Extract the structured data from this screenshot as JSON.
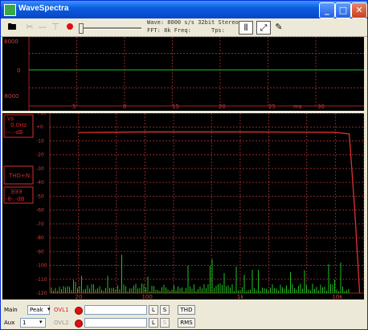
{
  "window": {
    "title": "WaveSpectra"
  },
  "titlebar_buttons": [
    "_",
    "□",
    "✕"
  ],
  "toolbar": {
    "info_line1": "Wave: 8000 s/s  32bit  Stereo",
    "info_line2": "FFT: 8k  Freq:",
    "tps_label": "Tps:"
  },
  "top_panel": {
    "y_labels": [
      "8000",
      "0",
      "-8000"
    ],
    "x_labels": [
      "5",
      "0",
      "15",
      "20",
      "25",
      "ms",
      "30"
    ]
  },
  "bottom_panel": {
    "left_box1": [
      "Vs",
      "0.0Hz",
      "---.-dB"
    ],
    "left_box2": "THD+N",
    "left_box3": [
      "ЭЭЭ",
      "-8-.-dB"
    ],
    "y_labels": [
      "+10",
      "+0",
      "-10",
      "-20",
      "-30",
      "-40",
      "-50",
      "-60",
      "-70",
      "-80",
      "-90",
      "-100",
      "-110",
      "-120"
    ],
    "x_labels": [
      "20",
      "100",
      "1k",
      "10k"
    ]
  },
  "chart_data": {
    "type": "line",
    "title": "",
    "xlabel": "",
    "ylabel": "",
    "x_scale": "log",
    "xlim": [
      10,
      20000
    ],
    "ylim": [
      -120,
      10
    ],
    "series": [
      {
        "x": [
          20,
          100,
          1000,
          10000,
          14000,
          16000,
          18000
        ],
        "y": [
          -4,
          -3.5,
          -3.5,
          -3.8,
          -5,
          -60,
          -120
        ]
      }
    ]
  },
  "bottom": {
    "main_label": "Main",
    "main_select": "Peak",
    "aux_label": "Aux",
    "aux_select": "1",
    "ovl1": "OVL1",
    "ovl2": "OVL2",
    "l_btn": "L",
    "s_btn": "S",
    "thd_btn": "THD",
    "rms_btn": "RMS"
  },
  "colors": {
    "trace": "#e03030",
    "grid": "#8b2a2a",
    "noise": "#1fbf1f",
    "axes": "#a02020"
  }
}
